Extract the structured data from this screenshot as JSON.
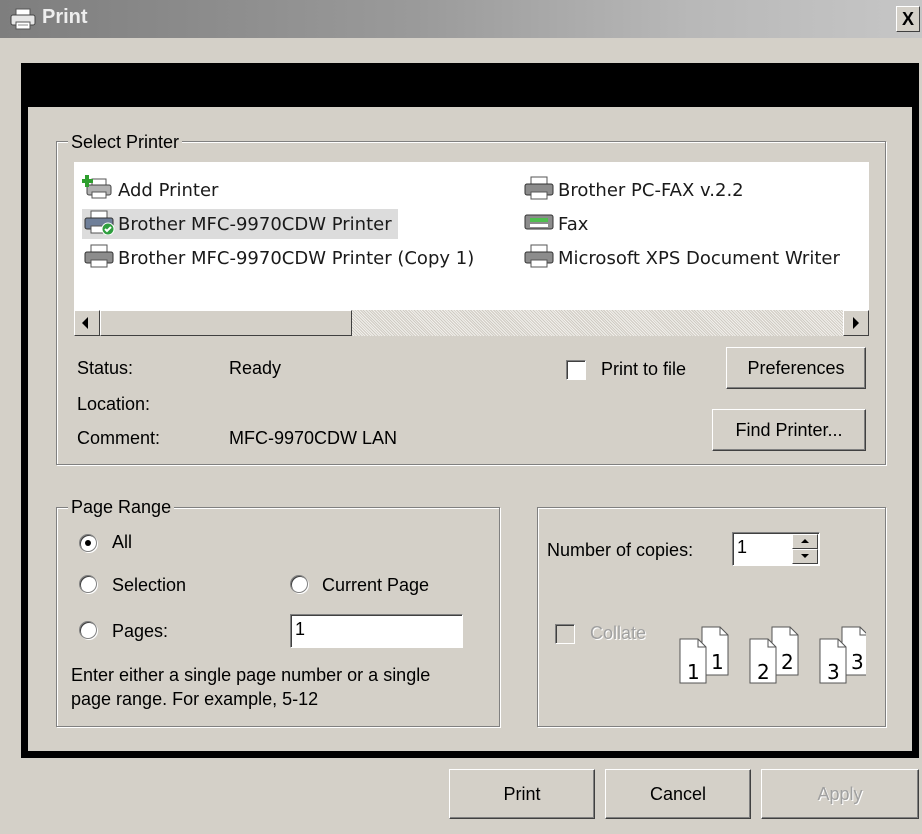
{
  "window": {
    "title": "Print",
    "close_glyph": "X",
    "title_icon": "printer-icon"
  },
  "select_printer": {
    "legend": "Select Printer",
    "items": [
      {
        "label": "Add Printer",
        "icon": "add-printer-icon"
      },
      {
        "label": "Brother PC-FAX v.2.2",
        "icon": "printer-icon"
      },
      {
        "label": "Brother MFC-9970CDW Printer",
        "icon": "default-printer-icon",
        "selected": true
      },
      {
        "label": "Fax",
        "icon": "fax-icon"
      },
      {
        "label": "Brother MFC-9970CDW Printer (Copy 1)",
        "icon": "printer-icon"
      },
      {
        "label": "Microsoft XPS Document Writer",
        "icon": "printer-icon"
      }
    ],
    "status_label": "Status:",
    "status_value": "Ready",
    "location_label": "Location:",
    "location_value": "",
    "comment_label": "Comment:",
    "comment_value": "MFC-9970CDW LAN",
    "print_to_file": {
      "label": "Print to file",
      "checked": false
    },
    "preferences_button": "Preferences",
    "find_printer_button": "Find Printer..."
  },
  "page_range": {
    "legend": "Page Range",
    "options": {
      "all": "All",
      "selection": "Selection",
      "current_page": "Current Page",
      "pages": "Pages:"
    },
    "selected": "all",
    "pages_value": "1",
    "hint_line1": "Enter either a single page number or a single",
    "hint_line2": "page range.  For example, 5-12"
  },
  "copies": {
    "label": "Number of copies:",
    "value": "1",
    "collate": {
      "label": "Collate",
      "checked": false,
      "enabled": false
    },
    "collate_pages": [
      "1",
      "1",
      "2",
      "2",
      "3",
      "3"
    ]
  },
  "footer": {
    "print": "Print",
    "cancel": "Cancel",
    "apply": "Apply"
  },
  "colors": {
    "dialog_bg": "#d4d0c8",
    "frame": "#000000",
    "selected_item": "#dcdcdc"
  }
}
